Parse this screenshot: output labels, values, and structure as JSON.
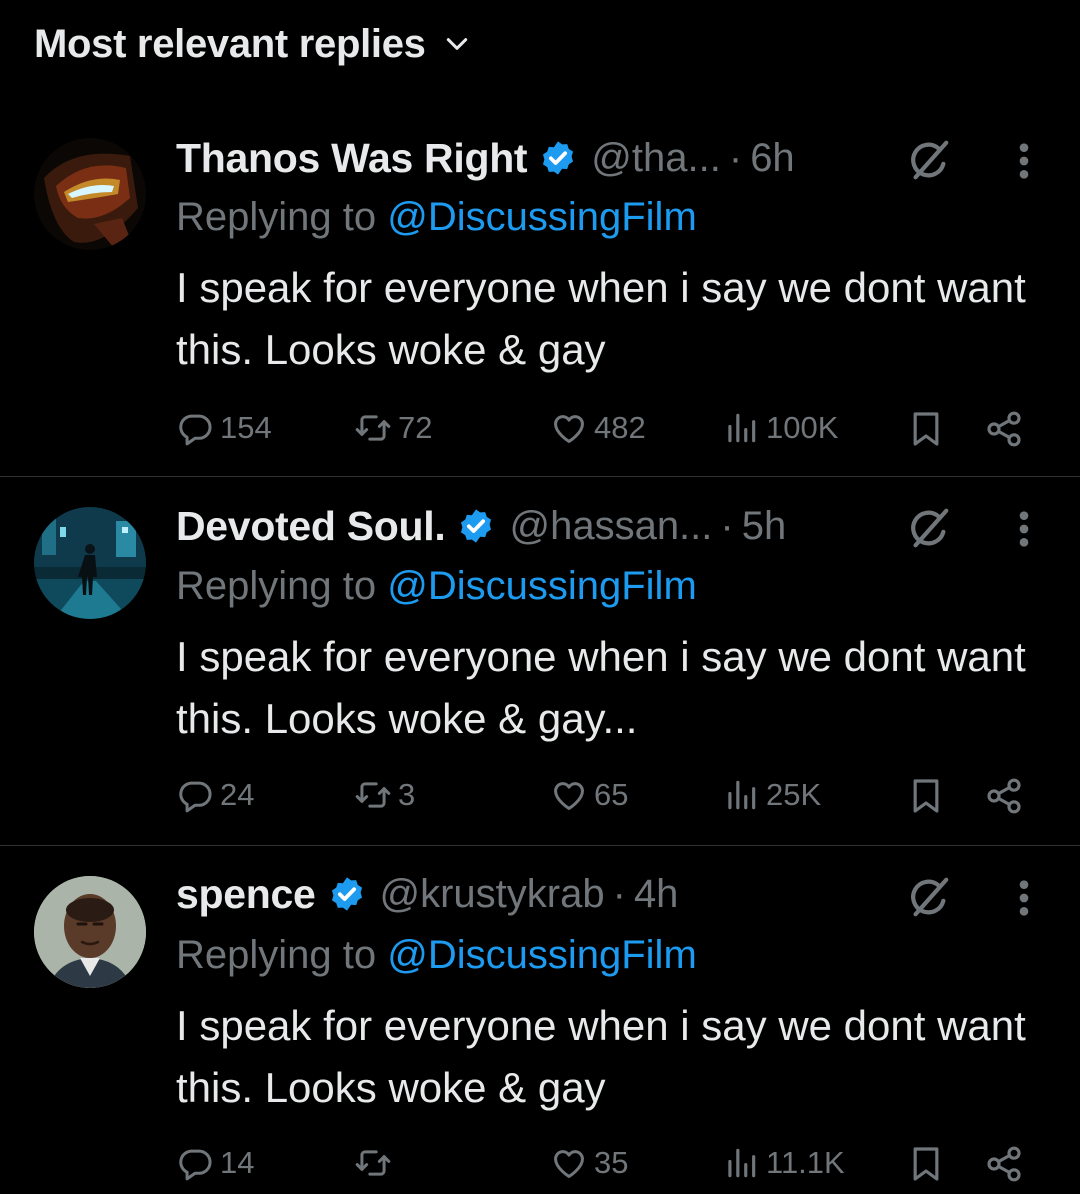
{
  "sort": {
    "label": "Most relevant replies"
  },
  "colors": {
    "background": "#000000",
    "text": "#e7e9ea",
    "muted": "#71767b",
    "link": "#1d9bf0",
    "divider": "#2f3336"
  },
  "icons": {
    "reply": "speech-bubble-icon",
    "repost": "repost-icon",
    "like": "heart-icon",
    "views": "bar-chart-icon",
    "bookmark": "bookmark-icon",
    "share": "share-icon",
    "verified": "verified-badge-icon",
    "grok": "grok-icon",
    "more": "more-vertical-icon"
  },
  "replies": [
    {
      "display_name": "Thanos Was Right",
      "handle": "@tha...",
      "time": "6h",
      "replying_prefix": "Replying to ",
      "replying_to": "@DiscussingFilm",
      "text": "I speak for everyone when i say we dont want this. Looks woke & gay",
      "stats": {
        "replies": "154",
        "reposts": "72",
        "likes": "482",
        "views": "100K"
      }
    },
    {
      "display_name": "Devoted Soul.",
      "handle": "@hassan...",
      "time": "5h",
      "replying_prefix": "Replying to ",
      "replying_to": "@DiscussingFilm",
      "text": "I speak for everyone when i say we dont want this. Looks woke & gay...",
      "stats": {
        "replies": "24",
        "reposts": "3",
        "likes": "65",
        "views": "25K"
      }
    },
    {
      "display_name": "spence",
      "handle": "@krustykrab",
      "time": "4h",
      "replying_prefix": "Replying to ",
      "replying_to": "@DiscussingFilm",
      "text": "I speak for everyone when i say we dont want this. Looks woke & gay",
      "stats": {
        "replies": "14",
        "reposts": "",
        "likes": "35",
        "views": "11.1K"
      }
    }
  ]
}
